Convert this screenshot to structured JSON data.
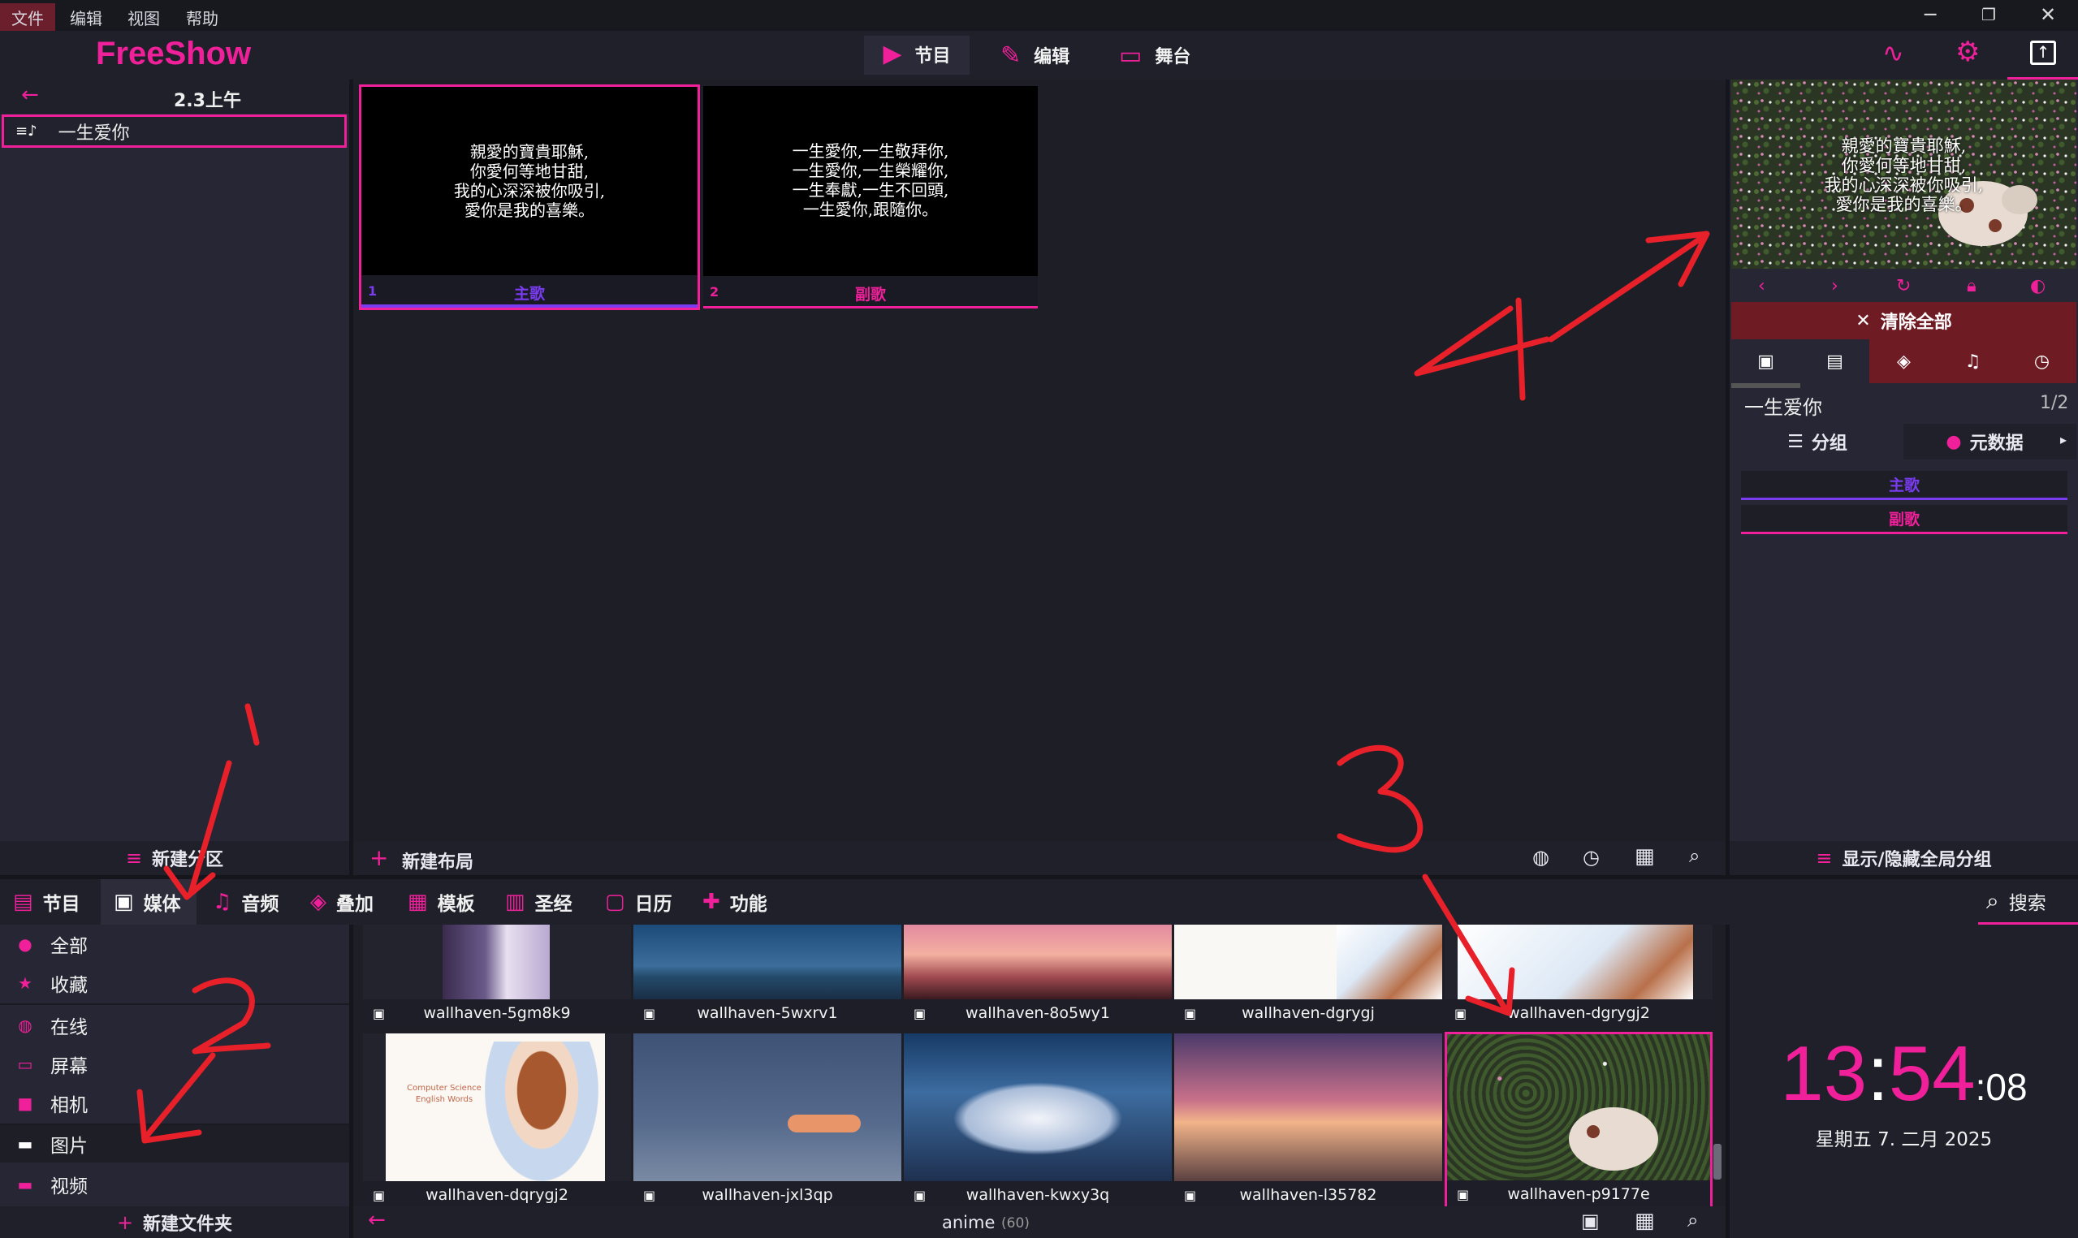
{
  "menubar": {
    "items": [
      "文件",
      "编辑",
      "视图",
      "帮助"
    ],
    "window_controls": [
      "─",
      "❐",
      "✕"
    ]
  },
  "app": {
    "logo": "FreeShow",
    "accent": "#f0209a"
  },
  "topnav": [
    {
      "label": "节目",
      "icon": "▶"
    },
    {
      "label": "编辑",
      "icon": "✎"
    },
    {
      "label": "舞台",
      "icon": "▭"
    }
  ],
  "left": {
    "back_icon": "←",
    "project_title": "2.3上午",
    "shows": [
      {
        "name": "一生爱你"
      }
    ],
    "new_project_label": "新建分区"
  },
  "slides": [
    {
      "index": "1",
      "group": "主歌",
      "group_color": "#7a3cf0",
      "lines": [
        "親愛的寶貴耶穌,",
        "你愛何等地甘甜,",
        "我的心深深被你吸引,",
        "愛你是我的喜樂。"
      ]
    },
    {
      "index": "2",
      "group": "副歌",
      "group_color": "#f0209a",
      "lines": [
        "一生愛你,一生敬拜你,",
        "一生愛你,一生榮耀你,",
        "一生奉獻,一生不回頭,",
        "一生愛你,跟隨你。"
      ]
    }
  ],
  "center": {
    "new_layout_label": "新建布局"
  },
  "output": {
    "preview_lines": [
      "親愛的寶貴耶穌,",
      "你愛何等地甘甜,",
      "我的心深深被你吸引,",
      "愛你是我的喜樂。"
    ],
    "clear_all_label": "清除全部",
    "show_name": "一生爱你",
    "slide_counter": "1/2",
    "groups_tab": "分组",
    "metadata_tab": "元数据",
    "groups": [
      {
        "name": "主歌",
        "color": "#7a3cf0"
      },
      {
        "name": "副歌",
        "color": "#f0209a"
      }
    ],
    "toggle_groups_label": "显示/隐藏全局分组"
  },
  "bottom_tabs": [
    {
      "label": "节目",
      "icon": "▤"
    },
    {
      "label": "媒体",
      "icon": "▣"
    },
    {
      "label": "音频",
      "icon": "♫"
    },
    {
      "label": "叠加",
      "icon": "◈"
    },
    {
      "label": "模板",
      "icon": "▦"
    },
    {
      "label": "圣经",
      "icon": "▥"
    },
    {
      "label": "日历",
      "icon": "▢"
    },
    {
      "label": "功能",
      "icon": "✚"
    }
  ],
  "search_label": "搜索",
  "media_side": [
    {
      "label": "全部",
      "icon": "●"
    },
    {
      "label": "收藏",
      "icon": "★"
    },
    {
      "label": "在线",
      "icon": "◍"
    },
    {
      "label": "屏幕",
      "icon": "▭"
    },
    {
      "label": "相机",
      "icon": "■"
    },
    {
      "label": "图片",
      "icon": "▬"
    },
    {
      "label": "视频",
      "icon": "▬"
    }
  ],
  "new_folder_label": "新建文件夹",
  "media_row1": [
    "wallhaven-5gm8k9",
    "wallhaven-5wxrv1",
    "wallhaven-8o5wy1",
    "wallhaven-dgrygj",
    "wallhaven-dgrygj2"
  ],
  "media_row2": [
    "wallhaven-dqrygj2",
    "wallhaven-jxl3qp",
    "wallhaven-kwxy3q",
    "wallhaven-l35782",
    "wallhaven-p9177e"
  ],
  "media_thumb_text": {
    "line1": "Computer Science",
    "line2": "English Words"
  },
  "folder": {
    "name": "anime",
    "count": "(60)"
  },
  "clock": {
    "hm_h": "13",
    "colon": ":",
    "hm_m": "54",
    "sec": ":08",
    "date": "星期五 7. 二月 2025"
  },
  "annotations": [
    "1",
    "2",
    "3",
    "4"
  ]
}
